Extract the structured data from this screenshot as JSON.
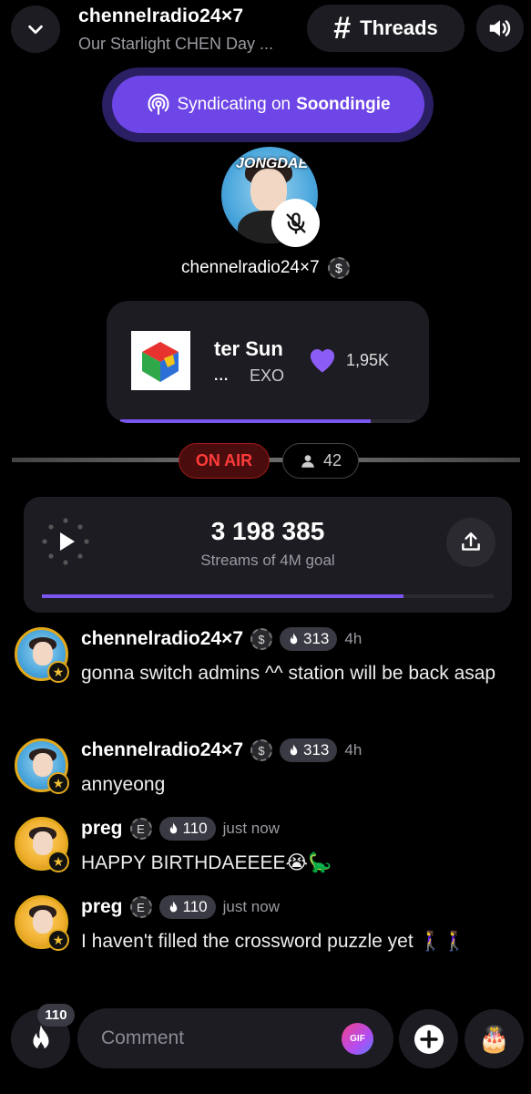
{
  "header": {
    "title": "chennelradio24×7",
    "subtitle": "Our Starlight CHEN Day ...",
    "threads_hash": "#",
    "threads_label": "Threads"
  },
  "syndicate": {
    "prefix": "Syndicating on",
    "brand": "Soondingie"
  },
  "host": {
    "avatar_text": "JONGDAE",
    "name": "chennelradio24×7",
    "badge": "$"
  },
  "now_playing": {
    "title": "ter Sun",
    "eq": "...",
    "artist": "EXO",
    "likes": "1,95K",
    "progress": 0.85
  },
  "status": {
    "on_air": "ON AIR",
    "listeners": "42"
  },
  "stream": {
    "count": "3 198 385",
    "goal": "Streams of 4M goal",
    "progress": 0.8
  },
  "messages": [
    {
      "user": "chennelradio24×7",
      "badge": "$",
      "fire": "313",
      "time": "4h",
      "text": "gonna switch admins ^^ station will be back asap",
      "avatar": "blue"
    },
    {
      "user": "chennelradio24×7",
      "badge": "$",
      "fire": "313",
      "time": "4h",
      "text": "annyeong",
      "avatar": "blue"
    },
    {
      "user": "preg",
      "badge": "E",
      "fire": "110",
      "time": "just now",
      "text": "HAPPY BIRTHDAEEEE😭🦕",
      "avatar": "yellow"
    },
    {
      "user": "preg",
      "badge": "E",
      "fire": "110",
      "time": "just now",
      "text": "I haven't filled the crossword puzzle yet 🚶‍♀️🚶‍♀️",
      "avatar": "yellow"
    }
  ],
  "composer": {
    "fire_count": "110",
    "placeholder": "Comment",
    "gif_label": "GIF",
    "cake": "🎂"
  },
  "colors": {
    "accent": "#6e45e6",
    "on_air_red": "#ff3b3b",
    "badge_gold": "#e2a81b"
  }
}
